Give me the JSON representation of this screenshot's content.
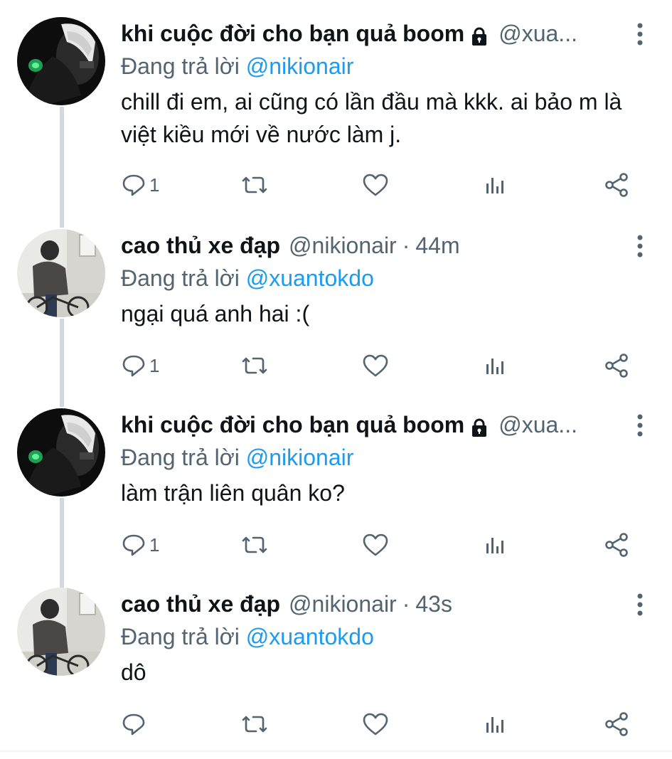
{
  "tweets": [
    {
      "name": "khi cuộc đời cho bạn quả boom",
      "handle": "@xua...",
      "time": "",
      "locked": true,
      "replying_prefix": "Đang trả lời",
      "replying_to": "@nikionair",
      "text": "chill đi em, ai cũng có lần đầu mà kkk. ai bảo m là việt kiều mới về nước làm j.",
      "reply_count": "1"
    },
    {
      "name": "cao thủ xe đạp",
      "handle": "@nikionair",
      "time": "44m",
      "locked": false,
      "replying_prefix": "Đang trả lời",
      "replying_to": "@xuantokdo",
      "text": "ngại quá anh hai :(",
      "reply_count": "1"
    },
    {
      "name": "khi cuộc đời cho bạn quả boom",
      "handle": "@xua...",
      "time": "",
      "locked": true,
      "replying_prefix": "Đang trả lời",
      "replying_to": "@nikionair",
      "text": "làm trận liên quân ko?",
      "reply_count": "1"
    },
    {
      "name": "cao thủ xe đạp",
      "handle": "@nikionair",
      "time": "43s",
      "locked": false,
      "replying_prefix": "Đang trả lời",
      "replying_to": "@xuantokdo",
      "text": "dô",
      "reply_count": ""
    }
  ],
  "time_separator": "·",
  "icons": {
    "reply": "reply-icon",
    "retweet": "retweet-icon",
    "like": "heart-icon",
    "analytics": "analytics-icon",
    "share": "share-icon",
    "more": "more-icon",
    "lock": "lock-icon"
  },
  "colors": {
    "link": "#1d9bf0",
    "secondary": "#536471",
    "thread_line": "#cfd9de"
  }
}
